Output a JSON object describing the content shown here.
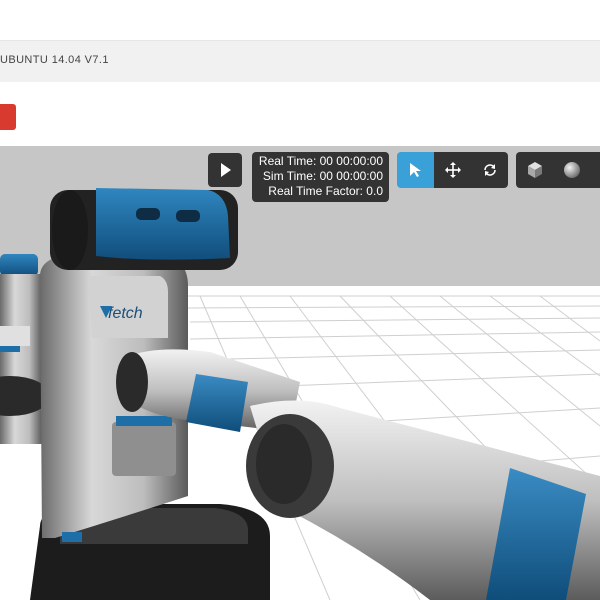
{
  "header": {
    "title": "UBUNTU 14.04 V7.1"
  },
  "actions": {
    "red_button_color": "#d93a2f"
  },
  "viewport": {
    "time_panel": {
      "real_time": "Real Time: 00 00:00:00",
      "sim_time": "Sim Time: 00 00:00:00",
      "real_time_factor": "Real Time Factor: 0.0"
    },
    "toolbar": {
      "active_tool": "select",
      "tools": [
        "select",
        "translate",
        "rotate"
      ],
      "shapes": [
        "box",
        "sphere"
      ]
    },
    "robot": {
      "logo_text": "fetch",
      "accent_color": "#1e6fa8"
    },
    "colors": {
      "sky": "#c6c6c6",
      "ground": "#ffffff",
      "grid": "#cfcfcf",
      "panel": "#333333",
      "active": "#3aa0d8"
    }
  }
}
